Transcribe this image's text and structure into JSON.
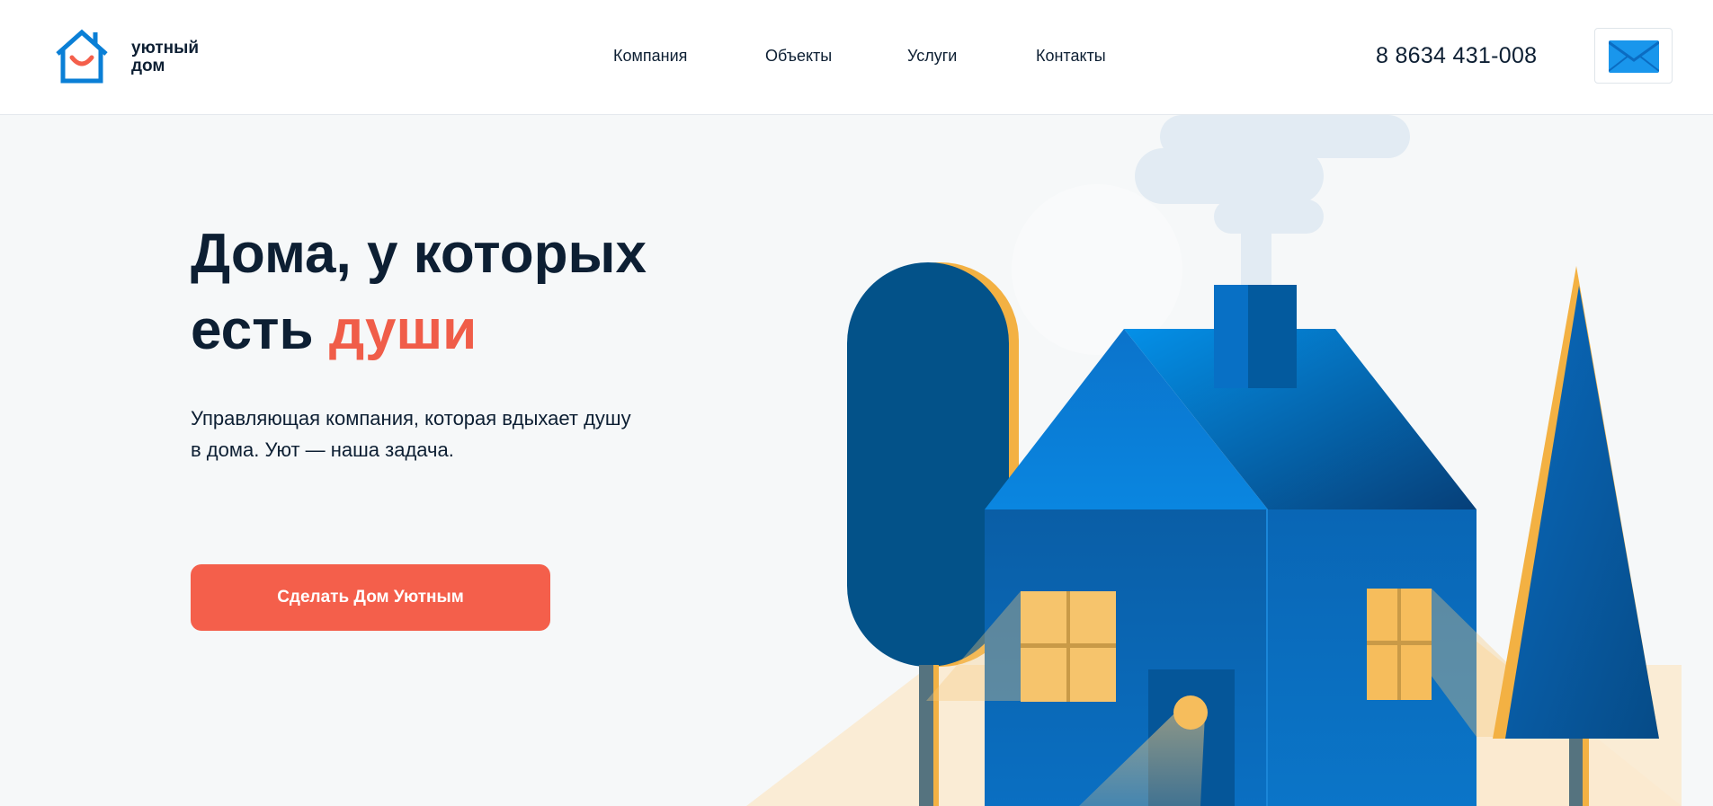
{
  "logo": {
    "line1": "уютный",
    "line2": "дом"
  },
  "nav": [
    "Компания",
    "Объекты",
    "Услуги",
    "Контакты"
  ],
  "phone": "8 8634 431-008",
  "hero": {
    "title_part1": "Дома, у которых",
    "title_part2": "есть ",
    "title_accent": "души",
    "subtitle_line1": "Управляющая компания, которая вдыхает душу",
    "subtitle_line2": "в дома. Уют — наша задача.",
    "cta_label": "Сделать Дом Уютным"
  },
  "icons": {
    "logo": "house-smile-icon",
    "mail": "envelope-icon"
  },
  "colors": {
    "accent": "#f45f4b",
    "brand_blue": "#0a7fd6",
    "dark_text": "#0d1f33",
    "window_yellow": "#f6b64f"
  }
}
